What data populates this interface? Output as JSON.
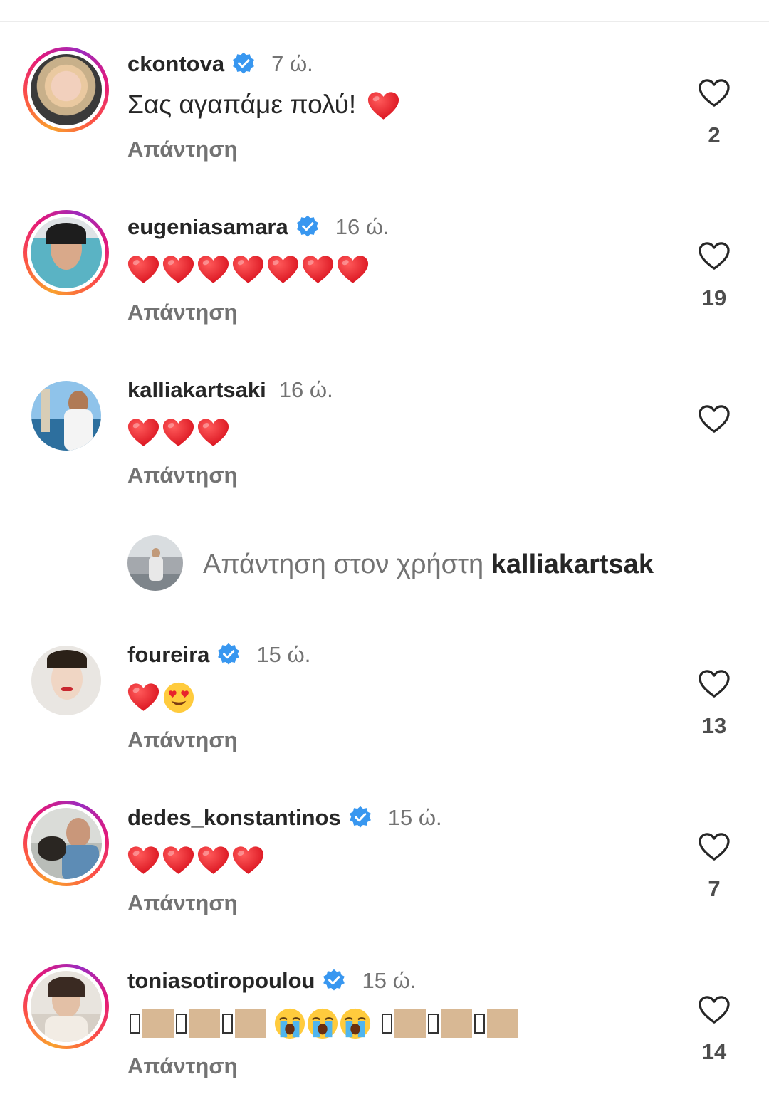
{
  "comments": [
    {
      "username": "ckontova",
      "verified": true,
      "time": "7 ώ.",
      "text": "Σας αγαπάμε πολύ!",
      "hearts": 1,
      "reply": "Απάντηση",
      "likes": "2",
      "ring": true
    },
    {
      "username": "eugeniasamara",
      "verified": true,
      "time": "16 ώ.",
      "hearts": 7,
      "reply": "Απάντηση",
      "likes": "19",
      "ring": true
    },
    {
      "username": "kalliakartsaki",
      "verified": false,
      "time": "16 ώ.",
      "hearts": 3,
      "reply": "Απάντηση",
      "likes": "",
      "ring": false
    },
    {
      "username": "foureira",
      "verified": true,
      "time": "15 ώ.",
      "emoji_note": "heart + heart-eyes face",
      "reply": "Απάντηση",
      "likes": "13",
      "ring": false
    },
    {
      "username": "dedes_konstantinos",
      "verified": true,
      "time": "15 ώ.",
      "hearts": 4,
      "reply": "Απάντηση",
      "likes": "7",
      "ring": true
    },
    {
      "username": "toniasotiropoulou",
      "verified": true,
      "time": "15 ώ.",
      "emoji_note": "unsupported glyphs + skin-tone boxes + loudly crying faces",
      "reply": "Απάντηση",
      "likes": "14",
      "ring": true
    }
  ],
  "thread_reply": {
    "prefix": "Απάντηση στον χρήστη",
    "target": "kalliakartsak"
  },
  "colors": {
    "verified": "#3897f0",
    "heart": "#ed1c24",
    "secondary_text": "#737373"
  },
  "icons": [
    "heart-outline-icon",
    "verified-badge-icon",
    "red-heart-emoji",
    "heart-eyes-emoji",
    "loudly-crying-emoji"
  ]
}
